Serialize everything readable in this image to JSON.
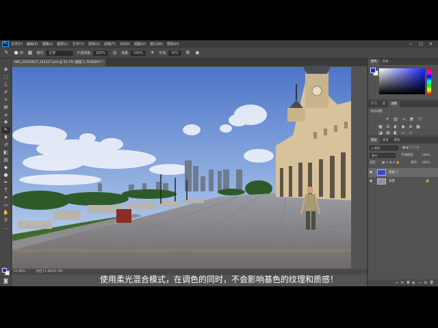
{
  "app": {
    "logo": "Ps",
    "menu": [
      "文件(F)",
      "编辑(E)",
      "图像(I)",
      "图层(L)",
      "文字(Y)",
      "选择(S)",
      "滤镜(T)",
      "3D(D)",
      "视图(V)",
      "窗口(W)",
      "帮助(H)"
    ],
    "window_buttons": [
      "—",
      "□",
      "✕"
    ]
  },
  "options": {
    "brush_size": "30",
    "mode_label": "模式:",
    "mode_value": "正常",
    "opacity_label": "不透明度:",
    "opacity_value": "100%",
    "flow_label": "流量:",
    "flow_value": "100%",
    "smoothing_label": "平滑:",
    "smoothing_value": "30%"
  },
  "document": {
    "tab_title": "IMG_20200627_144127.psd @ 52.7% (图层 1, RGB/8#) *",
    "close": "×",
    "zoom": "52.68%",
    "doc_size": "文档:11.8M/21.0M"
  },
  "panels": {
    "color_tabs": [
      "颜色",
      "色板"
    ],
    "learn_tabs": [
      "学习",
      "库",
      "调整"
    ],
    "adjust_label": "添加调整",
    "layer_tabs": [
      "图层",
      "通道",
      "路径"
    ],
    "kind_filter": "ρ 类型",
    "blend_mode": "柔光",
    "opacity_label": "不透明度:",
    "opacity_value": "100%",
    "lock_label": "锁定:",
    "fill_label": "填充:",
    "fill_value": "100%",
    "layers": [
      {
        "name": "图层 1",
        "selected": true
      },
      {
        "name": "背景",
        "selected": false,
        "locked": true
      }
    ]
  },
  "colors": {
    "foreground": "#1a30d8",
    "background": "#ffffff",
    "accent": "#31a8ff"
  },
  "subtitle": "使用柔光混合模式，在调色的同时，不会影响基色的纹理和质感！"
}
